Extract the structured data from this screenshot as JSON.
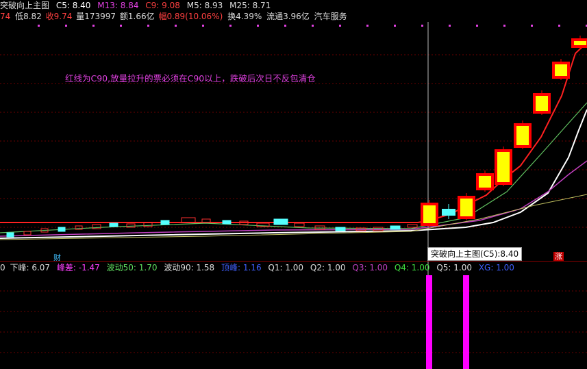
{
  "header": {
    "title": "突破向上主图",
    "ma_c5": "C5: 8.40",
    "ma_m13": "M13: 8.84",
    "ma_c9": "C9: 9.08",
    "ma_m5": "M5: 8.93",
    "ma_m25": "M25: 8.71",
    "left_fragment": "74",
    "low": "低8.82",
    "close": "收9.74",
    "volume": "量173997",
    "amount": "额1.66亿",
    "change": "幅0.89(10.06%)",
    "turnover": "换4.39%",
    "float_cap": "流通3.96亿",
    "sector": "汽车服务"
  },
  "annotation": "红线为C90,放量拉升的票必须在C90以上，跌破后次日不反包清仓",
  "tooltip": "突破向上主图(C5):8.40",
  "badges": {
    "cai": "财",
    "zhang": "涨"
  },
  "sub_indicator": {
    "left_fragment": "0",
    "xia_feng": "下峰: 6.07",
    "feng_cha": "峰差: -1.47",
    "bodong50": "波动50: 1.70",
    "bodong90": "波动90: 1.58",
    "feng_ding": "顶峰: 1.16",
    "q1": "Q1: 1.00",
    "q2": "Q2: 1.00",
    "q3": "Q3: 1.00",
    "q4": "Q4: 1.00",
    "q5": "Q5: 1.00",
    "xg": "XG: 1.00"
  },
  "colors": {
    "bg": "#000000",
    "up_body": "#ffff00",
    "up_border": "#ff0000",
    "down_candle": "#54ffff",
    "c90_line": "#ff2020",
    "ma_white": "#ffffff",
    "ma_magenta": "#c040c0",
    "ma_green": "#60c060",
    "ma_olive": "#c0c060",
    "xg_bar": "#ff00ff",
    "grid": "#6b0000"
  }
}
